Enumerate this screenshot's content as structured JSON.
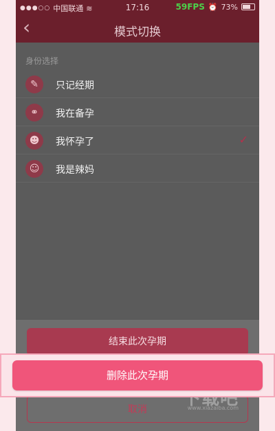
{
  "status_bar": {
    "carrier": "中国联通",
    "time": "17:16",
    "fps": "59FPS",
    "battery": "73%"
  },
  "nav": {
    "back": "‹",
    "title": "模式切换"
  },
  "section_label": "身份选择",
  "options": [
    {
      "label": "只记经期",
      "icon": "pen-icon",
      "glyph": "✎",
      "selected": false
    },
    {
      "label": "我在备孕",
      "icon": "rings-icon",
      "glyph": "⚭",
      "selected": false
    },
    {
      "label": "我怀孕了",
      "icon": "pregnant-icon",
      "glyph": "☻",
      "selected": true
    },
    {
      "label": "我是辣妈",
      "icon": "baby-icon",
      "glyph": "☺",
      "selected": false
    }
  ],
  "check_glyph": "✓",
  "action_sheet": {
    "end_label": "结束此次孕期",
    "delete_label": "删除此次孕期",
    "cancel_label": "取消"
  },
  "watermark": "下载吧",
  "watermark_sub": "www.xiazaiba.com",
  "colors": {
    "nav": "#6b1f2c",
    "accent": "#f0557a",
    "check": "#b5304c"
  }
}
